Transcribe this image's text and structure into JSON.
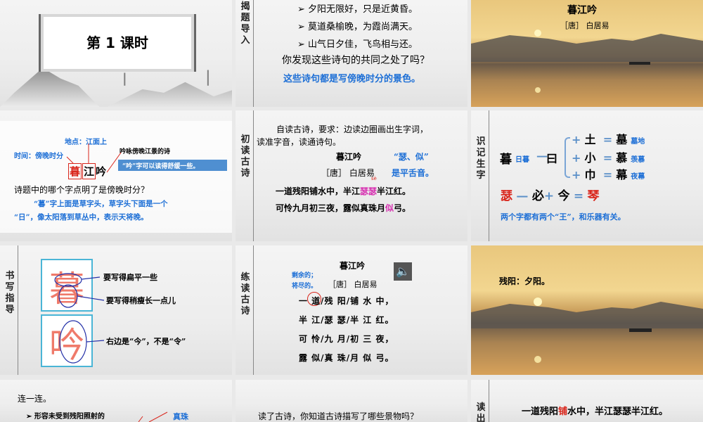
{
  "s1": {
    "title": "第 1 课时"
  },
  "s2": {
    "side": "揭题导入",
    "lines": [
      "➢ 夕阳无限好，只是近黄昏。",
      "➢ 莫道桑榆晚，为霞尚满天。",
      "➢ 山气日夕佳，飞鸟相与还。"
    ],
    "question": "你发现这些诗句的共同之处了吗？",
    "answer": "这些诗句都是写傍晚时分的景色。"
  },
  "s3": {
    "title": "暮江吟",
    "author": "［唐］ 白居易"
  },
  "s4": {
    "place": "地点：江面上",
    "time": "时间：傍晚时分",
    "note": "吟咏傍晚江景的诗",
    "chars": [
      "暮",
      "江",
      "吟"
    ],
    "tip": "“吟”字可以读得舒缓一些。",
    "question": "诗题中的哪个字点明了是傍晚时分？",
    "answer1": "“暮”字上面是草字头，草字头下面是一个",
    "answer2": "“日”，像太阳落到草丛中，表示天将晚。"
  },
  "s5": {
    "side": "初读古诗",
    "instr1": "自读古诗，要求：边读边圈画出生字词，",
    "instr2": "读准字音，读通诗句。",
    "title": "暮江吟",
    "author": "［唐］ 白居易",
    "pinyin": "sè",
    "note1": "“瑟、似”",
    "note2": "是平舌音。",
    "line1a": "一道残阳铺水中，半江",
    "line1b": "瑟瑟",
    "line1c": "半江红。",
    "line2a": "可怜九月初三夜，露似真珠月",
    "line2b": "似",
    "line2c": "弓。"
  },
  "s6": {
    "side": "识记生字",
    "base": "暮",
    "base_word": "日暮",
    "minus": "—",
    "part": "曰",
    "plus": "+",
    "eq": "=",
    "rows": [
      {
        "add": "土",
        "result": "墓",
        "word": "墓地"
      },
      {
        "add": "小",
        "result": "慕",
        "word": "羡慕"
      },
      {
        "add": "巾",
        "result": "幕",
        "word": "夜幕"
      }
    ],
    "s_char": "瑟",
    "s_minus": "必",
    "s_add": "今",
    "s_result": "琴",
    "note": "两个字都有两个“王”，和乐器有关。"
  },
  "s7": {
    "side": "书写指导",
    "char1": "暮",
    "char2": "吟",
    "note1": "要写得扁平一些",
    "note2": "要写得稍瘦长一点儿",
    "note3": "右边是“今”，不是“令”"
  },
  "s8": {
    "side": "练读古诗",
    "title": "暮江吟",
    "gloss1": "剩余的；",
    "gloss2": "将尽的。",
    "author": "［唐］ 白居易",
    "lines": [
      "一 道/残 阳/铺 水 中，",
      "半 江/瑟 瑟/半 江 红。",
      "可 怜/九 月/初 三 夜，",
      "露 似/真 珠/月 似 弓。"
    ]
  },
  "s9": {
    "text": "残阳：夕阳。"
  },
  "s10": {
    "title": "连一连。",
    "item": "➢ 形容未受到残阳照射的",
    "word": "真珠"
  },
  "s11": {
    "question": "读了古诗，你知道古诗描写了哪些景物吗？"
  },
  "s12": {
    "side": "读出",
    "pre": "一道残阳",
    "hl": "铺",
    "post": "水中，半江瑟瑟半江红。"
  }
}
